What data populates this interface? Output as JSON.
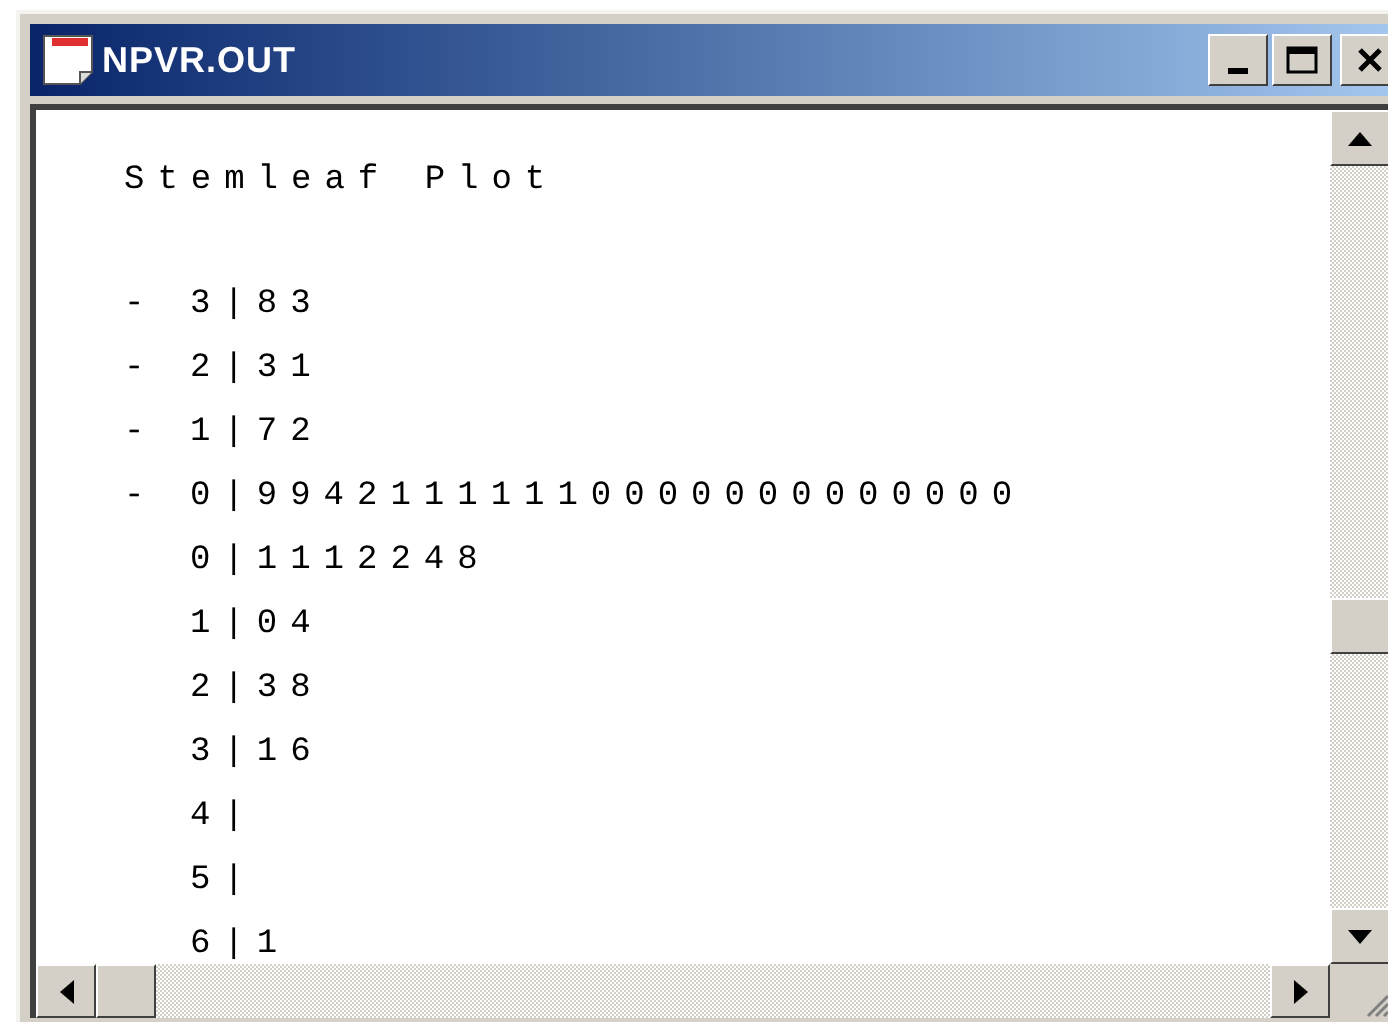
{
  "window": {
    "title": "NPVR.OUT"
  },
  "content": {
    "heading": "Stemleaf Plot",
    "rows": [
      {
        "sign": "-",
        "text": "3|83"
      },
      {
        "sign": "-",
        "text": "2|31"
      },
      {
        "sign": "-",
        "text": "1|72"
      },
      {
        "sign": "-",
        "text": "0|99421111110000000000000"
      },
      {
        "text": "0|1112248"
      },
      {
        "text": "1|04"
      },
      {
        "text": "2|38"
      },
      {
        "text": "3|16"
      },
      {
        "text": "4|"
      },
      {
        "text": "5|"
      },
      {
        "text": "6|1"
      }
    ]
  }
}
